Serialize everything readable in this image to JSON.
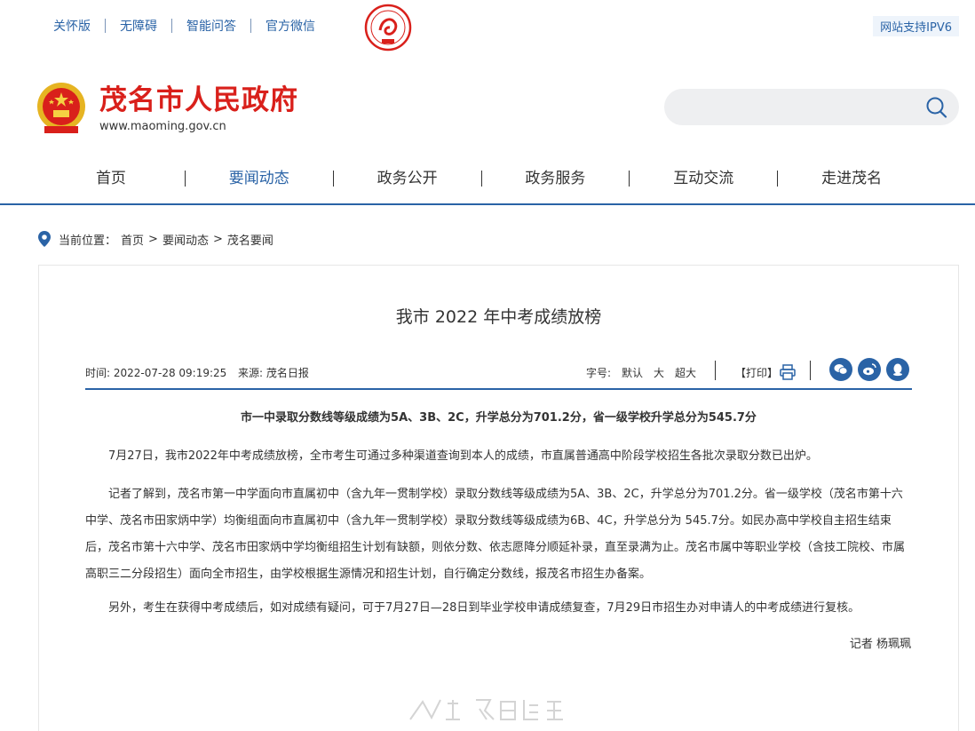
{
  "topbar": {
    "links": [
      "关怀版",
      "无障碍",
      "智能问答",
      "官方微信"
    ],
    "ipv6": "网站支持IPV6"
  },
  "brand": {
    "title": "茂名市人民政府",
    "url": "www.maoming.gov.cn"
  },
  "search": {
    "placeholder": ""
  },
  "nav": {
    "items": [
      "首页",
      "要闻动态",
      "政务公开",
      "政务服务",
      "互动交流",
      "走进茂名"
    ],
    "active_index": 1
  },
  "breadcrumb": {
    "label": "当前位置：",
    "items": [
      "首页",
      "要闻动态",
      "茂名要闻"
    ],
    "separator": ">"
  },
  "article": {
    "title": "我市 2022 年中考成绩放榜",
    "time": "时间: 2022-07-28 09:19:25",
    "source": "来源: 茂名日报",
    "fontsize_label": "字号:",
    "fontsize_options": [
      "默认",
      "大",
      "超大"
    ],
    "print_label": "【打印】",
    "lead": "市一中录取分数线等级成绩为5A、3B、2C，升学总分为701.2分，省一级学校升学总分为545.7分",
    "paragraphs": [
      "7月27日，我市2022年中考成绩放榜，全市考生可通过多种渠道查询到本人的成绩，市直属普通高中阶段学校招生各批次录取分数已出炉。",
      "记者了解到，茂名市第一中学面向市直属初中（含九年一贯制学校）录取分数线等级成绩为5A、3B、2C，升学总分为701.2分。省一级学校（茂名市第十六中学、茂名市田家炳中学）均衡组面向市直属初中（含九年一贯制学校）录取分数线等级成绩为6B、4C，升学总分为 545.7分。如民办高中学校自主招生结束后，茂名市第十六中学、茂名市田家炳中学均衡组招生计划有缺额，则依分数、依志愿降分顺延补录，直至录满为止。茂名市属中等职业学校（含技工院校、市属高职三二分段招生）面向全市招生，由学校根据生源情况和招生计划，自行确定分数线，报茂名市招生办备案。",
      "另外，考生在获得中考成绩后，如对成绩有疑问，可于7月27日—28日到毕业学校申请成绩复查，7月29日市招生办对申请人的中考成绩进行复核。"
    ],
    "author": "记者 杨珮珮"
  },
  "colors": {
    "brand_red": "#d9201b",
    "nav_blue": "#2a63a6"
  }
}
